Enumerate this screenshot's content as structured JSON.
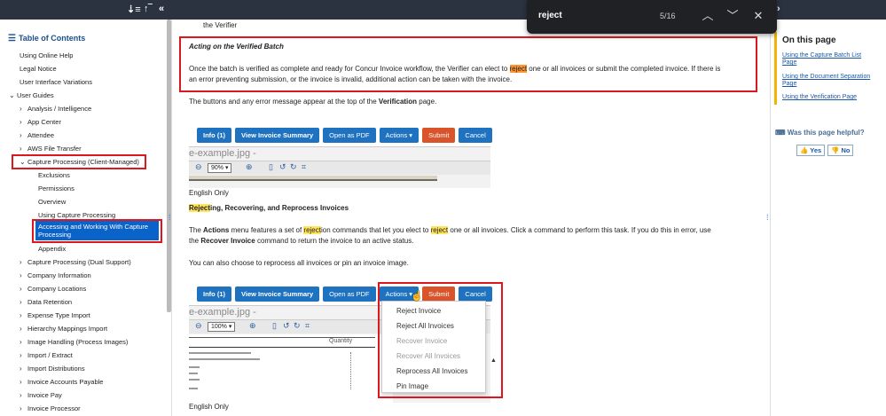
{
  "find": {
    "query": "reject",
    "count": "5/16"
  },
  "sidebar": {
    "title": "Table of Contents",
    "items": [
      {
        "label": "Using Online Help",
        "chev": ""
      },
      {
        "label": "Legal Notice",
        "chev": ""
      },
      {
        "label": "User Interface Variations",
        "chev": ""
      },
      {
        "label": "User Guides",
        "chev": "v"
      },
      {
        "label": "Analysis / Intelligence",
        "chev": ">"
      },
      {
        "label": "App Center",
        "chev": ">"
      },
      {
        "label": "Attendee",
        "chev": ">"
      },
      {
        "label": "AWS File Transfer",
        "chev": ">"
      },
      {
        "label": "Capture Processing (Client-Managed)",
        "chev": "v"
      },
      {
        "label": "Exclusions",
        "chev": ""
      },
      {
        "label": "Permissions",
        "chev": ""
      },
      {
        "label": "Overview",
        "chev": ""
      },
      {
        "label": "Using Capture Processing",
        "chev": ""
      },
      {
        "label": "Accessing and Working With Capture Processing",
        "chev": ""
      },
      {
        "label": "Appendix",
        "chev": ""
      },
      {
        "label": "Capture Processing (Dual Support)",
        "chev": ">"
      },
      {
        "label": "Company Information",
        "chev": ">"
      },
      {
        "label": "Company Locations",
        "chev": ">"
      },
      {
        "label": "Data Retention",
        "chev": ">"
      },
      {
        "label": "Expense Type Import",
        "chev": ">"
      },
      {
        "label": "Hierarchy Mappings Import",
        "chev": ">"
      },
      {
        "label": "Image Handling (Process Images)",
        "chev": ">"
      },
      {
        "label": "Import / Extract",
        "chev": ">"
      },
      {
        "label": "Import Distributions",
        "chev": ">"
      },
      {
        "label": "Invoice Accounts Payable",
        "chev": ">"
      },
      {
        "label": "Invoice Pay",
        "chev": ">"
      },
      {
        "label": "Invoice Processor",
        "chev": ">"
      }
    ]
  },
  "main": {
    "top_fragment": "the Verifier",
    "section1_heading": "Acting on the Verified Batch",
    "section1_p_a": "Once the batch is verified as complete and ready for Concur Invoice workflow, the Verifier can elect to ",
    "section1_p_hl": "reject",
    "section1_p_b": " one or all invoices or submit the completed invoice. If there is",
    "section1_p_line2": "an error preventing submission, or the invoice is invalid, additional action can be taken with the invoice.",
    "buttons_text_a": "The buttons and any error message appear at the top of the ",
    "buttons_text_bold": "Verification",
    "buttons_text_b": " page.",
    "toolbar1": {
      "info": "Info (1)",
      "view_summary": "View Invoice Summary",
      "open_pdf": "Open as PDF",
      "actions": "Actions",
      "submit": "Submit",
      "cancel": "Cancel",
      "filename": "e-example.jpg -",
      "zoom": "90%"
    },
    "english_only_1": "English Only",
    "section2_heading_hl": "Reject",
    "section2_heading_rest": "ing, Recovering, and Reprocess Invoices",
    "p2_a": "The ",
    "p2_actions": "Actions",
    "p2_b": " menu features a set of ",
    "p2_hl1": "reject",
    "p2_c": "ion commands that let you elect to ",
    "p2_hl2": "reject",
    "p2_d": " one or all invoices. Click a command to perform this task. If you do this in error, use",
    "p2_e": "the ",
    "p2_recover": "Recover Invoice",
    "p2_f": " command to return the invoice to an active status.",
    "p3": "You can also choose to reprocess all invoices or pin an invoice image.",
    "toolbar2": {
      "info": "Info (1)",
      "view_summary": "View Invoice Summary",
      "open_pdf": "Open as PDF",
      "actions": "Actions",
      "submit": "Submit",
      "cancel": "Cancel",
      "filename": "e-example.jpg -",
      "zoom": "100%",
      "quantity_header": "Quantity"
    },
    "menu": [
      {
        "label": "Reject Invoice",
        "disabled": false
      },
      {
        "label": "Reject All Invoices",
        "disabled": false
      },
      {
        "label": "Recover Invoice",
        "disabled": true
      },
      {
        "label": "Recover All Invoices",
        "disabled": true
      },
      {
        "label": "Reprocess All Invoices",
        "disabled": false
      },
      {
        "label": "Pin Image",
        "disabled": false
      }
    ],
    "english_only_2": "English Only"
  },
  "right": {
    "on_this_page": "On this page",
    "links": [
      "Using the Capture Batch List Page",
      "Using the Document Separation Page",
      "Using the Verification Page"
    ],
    "helpful": "Was this page helpful?",
    "yes": "Yes",
    "no": "No"
  }
}
